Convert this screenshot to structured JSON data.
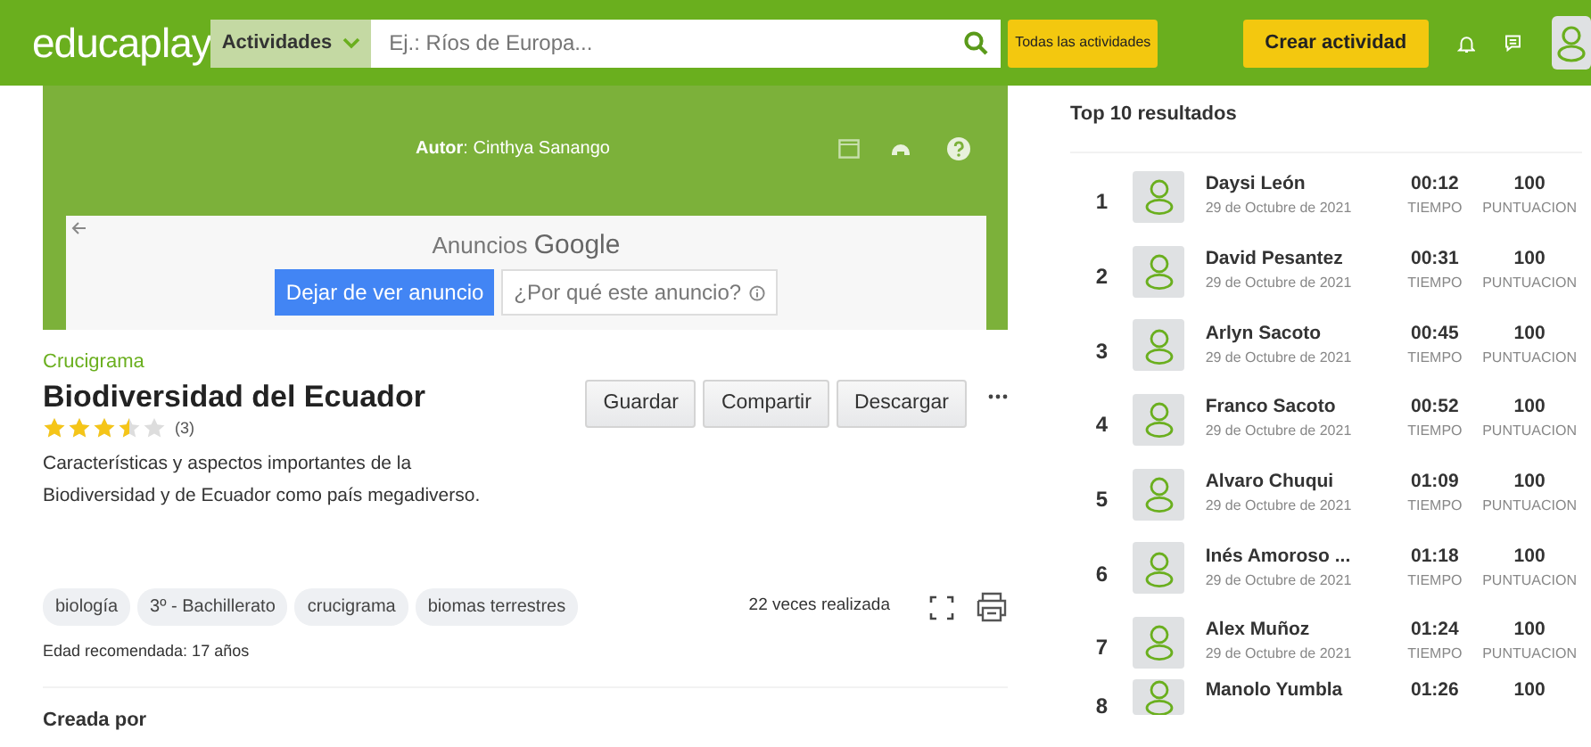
{
  "header": {
    "logo": "educaplay",
    "category_select": "Actividades",
    "search": {
      "placeholder": "Ej.: Ríos de Europa..."
    },
    "all_activities_button": "Todas las actividades",
    "create_button": "Crear actividad"
  },
  "game_panel": {
    "author": "**Autor**: Cinthya Sanango"
  },
  "ad": {
    "title": "Anuncios",
    "brand": "Google",
    "stop_button": "Dejar de ver anuncio",
    "why_button": "¿Por qué este anuncio?"
  },
  "activity": {
    "type": "Crucigrama",
    "title": "Biodiversidad del Ecuador",
    "stars": 3.5,
    "rating_count": "(3)",
    "description": "Características y aspectos importantes de la Biodiversidad y de Ecuador como país megadiverso.",
    "actions": [
      "Guardar",
      "Compartir",
      "Descargar"
    ],
    "tags": [
      "biología",
      "3º - Bachillerato",
      "crucigrama",
      "biomas terrestres"
    ],
    "plays": "22 veces realizada",
    "age": "Edad recomendada: 17 años",
    "created_by": "Creada por"
  },
  "ranking": {
    "title": "Top 10 resultados",
    "rows": [
      {
        "rank": "1",
        "name": "Daysi León",
        "date": "29 de Octubre de 2021",
        "time": "00:12",
        "time_label": "TIEMPO",
        "score": "100",
        "score_label": "PUNTUACION"
      },
      {
        "rank": "2",
        "name": "David Pesantez",
        "date": "29 de Octubre de 2021",
        "time": "00:31",
        "time_label": "TIEMPO",
        "score": "100",
        "score_label": "PUNTUACION"
      },
      {
        "rank": "3",
        "name": "Arlyn Sacoto",
        "date": "29 de Octubre de 2021",
        "time": "00:45",
        "time_label": "TIEMPO",
        "score": "100",
        "score_label": "PUNTUACION"
      },
      {
        "rank": "4",
        "name": "Franco Sacoto",
        "date": "29 de Octubre de 2021",
        "time": "00:52",
        "time_label": "TIEMPO",
        "score": "100",
        "score_label": "PUNTUACION"
      },
      {
        "rank": "5",
        "name": "Alvaro Chuqui",
        "date": "29 de Octubre de 2021",
        "time": "01:09",
        "time_label": "TIEMPO",
        "score": "100",
        "score_label": "PUNTUACION"
      },
      {
        "rank": "6",
        "name": "Inés Amoroso ...",
        "date": "29 de Octubre de 2021",
        "time": "01:18",
        "time_label": "TIEMPO",
        "score": "100",
        "score_label": "PUNTUACION"
      },
      {
        "rank": "7",
        "name": "Alex Muñoz",
        "date": "29 de Octubre de 2021",
        "time": "01:24",
        "time_label": "TIEMPO",
        "score": "100",
        "score_label": "PUNTUACION"
      },
      {
        "rank": "8",
        "name": "Manolo Yumbla",
        "time": "01:26",
        "score": "100"
      }
    ]
  }
}
